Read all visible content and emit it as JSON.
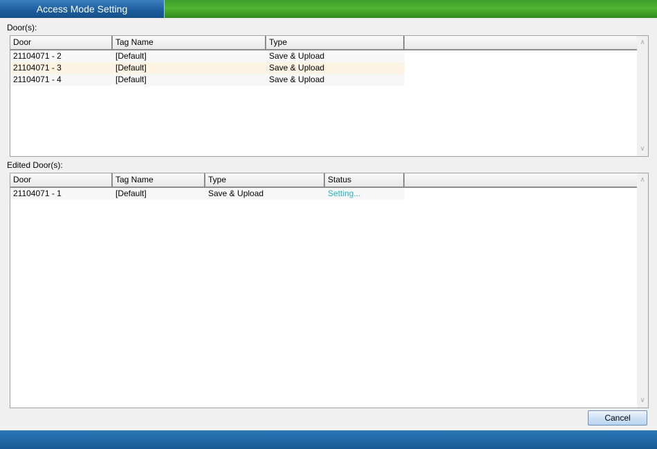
{
  "window": {
    "title": "Access Mode Setting"
  },
  "doors": {
    "label": "Door(s):",
    "columns": [
      "Door",
      "Tag Name",
      "Type"
    ],
    "rows": [
      {
        "door": "21104071 - 2",
        "tag": "[Default]",
        "type": "Save & Upload"
      },
      {
        "door": "21104071 - 3",
        "tag": "[Default]",
        "type": "Save & Upload"
      },
      {
        "door": "21104071 - 4",
        "tag": "[Default]",
        "type": "Save & Upload"
      }
    ]
  },
  "edited": {
    "label": "Edited Door(s):",
    "columns": [
      "Door",
      "Tag Name",
      "Type",
      "Status"
    ],
    "rows": [
      {
        "door": "21104071 - 1",
        "tag": "[Default]",
        "type": "Save & Upload",
        "status": "Setting..."
      }
    ]
  },
  "buttons": {
    "cancel": "Cancel"
  },
  "icons": {
    "scroll_up": "chevron-up-icon",
    "scroll_down": "chevron-down-icon"
  },
  "colors": {
    "title_tab": "#1d5f9f",
    "title_bar": "#4fb733",
    "status_text": "#27b3c3",
    "footer": "#175a94"
  }
}
